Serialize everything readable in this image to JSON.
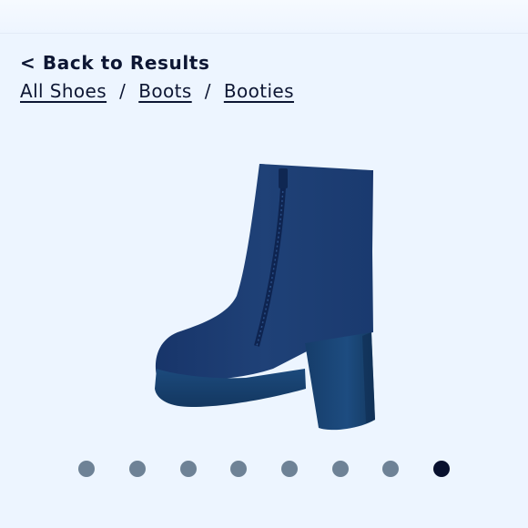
{
  "nav": {
    "back_label": "< Back to Results"
  },
  "breadcrumb": {
    "items": [
      {
        "label": "All Shoes"
      },
      {
        "label": "Boots"
      },
      {
        "label": "Booties"
      }
    ],
    "separator": "/"
  },
  "gallery": {
    "image_icon": "navy-heeled-ankle-bootie-image",
    "slide_count": 8,
    "active_slide": 8,
    "dot_color": "#6e8296",
    "active_dot_color": "#08102e"
  },
  "colors": {
    "background": "#edf5ff",
    "text": "#0d1633",
    "boot": "#1d3f74"
  }
}
